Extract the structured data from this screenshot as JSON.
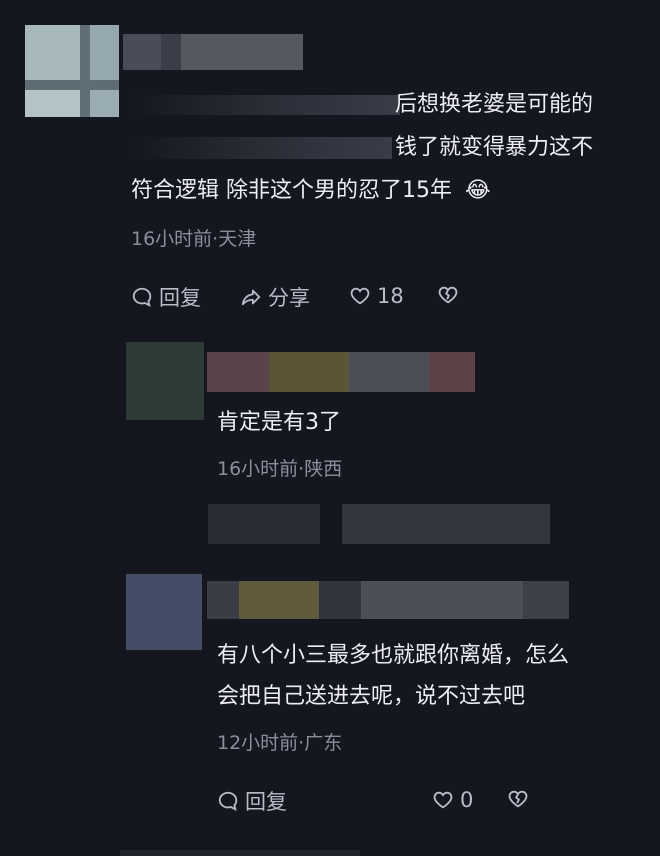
{
  "comment1": {
    "lines": [
      "后想换老婆是可能的",
      "钱了就变得暴力这不",
      "符合逻辑  除非这个男的忍了15年"
    ],
    "emoji": "😂",
    "time_location": "16小时前·天津",
    "actions": {
      "reply": "回复",
      "share": "分享",
      "like_count": "18"
    }
  },
  "reply1": {
    "text": "肯定是有3了",
    "time_location": "16小时前·陕西"
  },
  "reply2": {
    "lines": [
      "有八个小三最多也就跟你离婚，怎么",
      "会把自己送进去呢，说不过去吧"
    ],
    "time_location": "12小时前·广东",
    "actions": {
      "reply": "回复",
      "like_count": "0"
    }
  },
  "colors": {
    "background": "#141620",
    "text": "#ededf2",
    "meta": "#8c8f9a",
    "icon": "#b9bcc6"
  },
  "icons": [
    "chat-bubble-icon",
    "share-arrow-icon",
    "heart-icon",
    "broken-heart-icon"
  ]
}
